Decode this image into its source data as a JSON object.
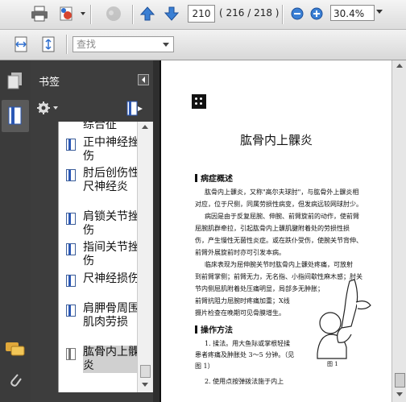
{
  "toolbar": {
    "page_number": "210",
    "page_count": "( 216 / 218 )",
    "zoom_value": "30.4%",
    "search_placeholder": "查找"
  },
  "panel": {
    "title": "书签"
  },
  "bookmarks": [
    {
      "label": "综合征",
      "icon": "bookmark-icon"
    },
    {
      "label": "正中神经挫伤",
      "icon": "bookmark-icon"
    },
    {
      "label": "肘后创伤性尺神经炎",
      "icon": "bookmark-icon"
    },
    {
      "label": "肩锁关节挫伤",
      "icon": "bookmark-icon"
    },
    {
      "label": "指间关节挫伤",
      "icon": "bookmark-icon"
    },
    {
      "label": "尺神经损伤",
      "icon": "bookmark-icon"
    },
    {
      "label": "肩胛骨周围肌肉劳损",
      "icon": "bookmark-icon"
    },
    {
      "label": "肱骨内上髁炎",
      "icon": "bookmark-icon",
      "selected": true
    }
  ],
  "document": {
    "title": "肱骨内上髁炎",
    "section1": "病症概述",
    "para1": [
      "肱骨内上髁炎，又称\"高尔夫球肘\"，与肱骨外上髁炎相",
      "对应，位于尺侧，同属劳损性病变，但发病远较网球肘少。",
      "病因是由于反复屈腕、伸腕、前臂旋前的动作，使前臂",
      "屈腕肌群牵拉，引起肱骨内上髁肌腱附着处的劳损性损",
      "伤，产生慢性无菌性炎症。或在跌仆受伤，使腕关节背伸、",
      "前臂外展旋前时亦可引发本病。"
    ],
    "para2": [
      "临床表现为屈伸腕关节时肱骨内上髁处疼痛，可放射",
      "到前臂掌侧；前臂无力，无名指、小指间歇性麻木感；肘关",
      "节内侧屈肌附着处压痛明显，局部多无肿胀；",
      "前臂抗阻力屈腕时疼痛加重；X线",
      "摄片检查在晚期可见骨膜增生。"
    ],
    "section2": "操作方法",
    "para3": [
      "1. 揉法。用大鱼际或掌根轻揉",
      "患者疼痛及肿胀处 3～5 分钟。（见",
      "图 1）",
      "2. 使用点按弹拨法施于内上"
    ],
    "figure_caption": "图 1"
  }
}
